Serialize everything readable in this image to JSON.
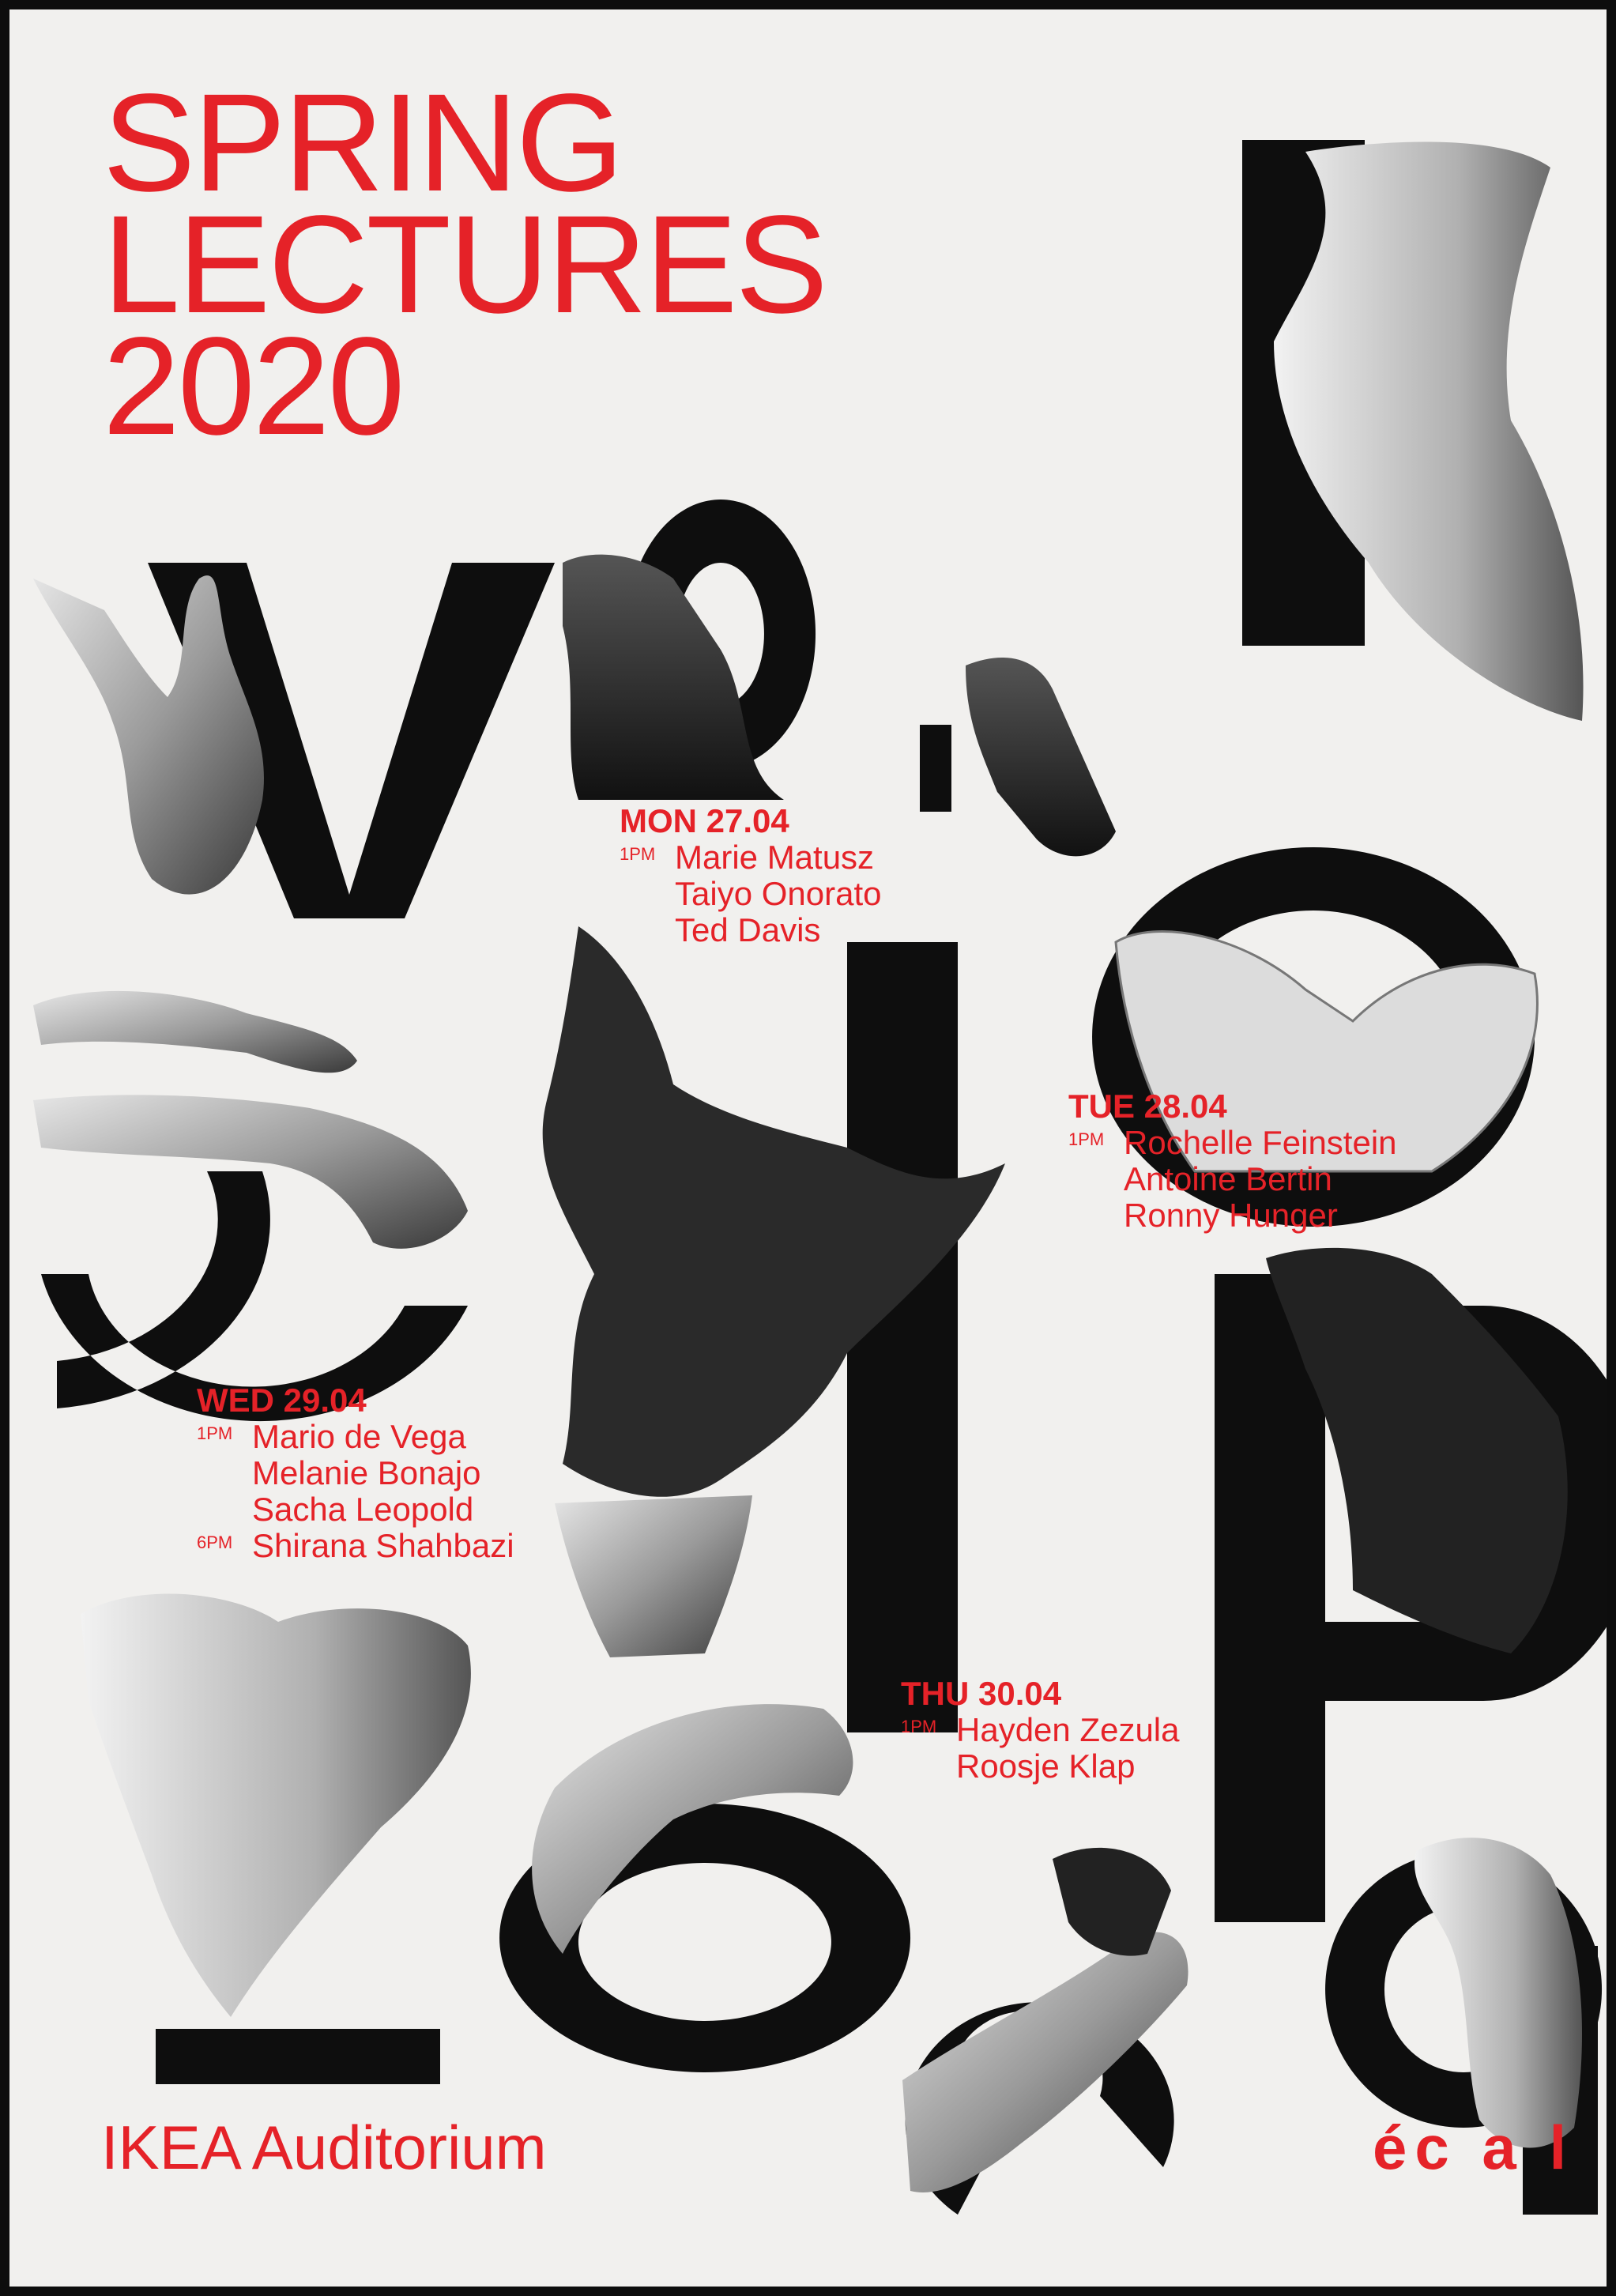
{
  "title": {
    "line1": "SPRING",
    "line2": "LECTURES",
    "line3": "2020"
  },
  "schedule": [
    {
      "day": "MON 27.04",
      "slots": [
        {
          "time": "1PM",
          "names": [
            "Marie Matusz",
            "Taiyo Onorato",
            "Ted Davis"
          ]
        }
      ]
    },
    {
      "day": "TUE 28.04",
      "slots": [
        {
          "time": "1PM",
          "names": [
            "Rochelle Feinstein",
            "Antoine Bertin",
            "Ronny Hunger"
          ]
        }
      ]
    },
    {
      "day": "WED 29.04",
      "slots": [
        {
          "time": "1PM",
          "names": [
            "Mario de Vega",
            "Melanie Bonajo",
            "Sacha Leopold"
          ]
        },
        {
          "time": "6PM",
          "names": [
            "Shirana Shahbazi"
          ]
        }
      ]
    },
    {
      "day": "THU 30.04",
      "slots": [
        {
          "time": "1PM",
          "names": [
            "Hayden Zezula",
            "Roosje Klap"
          ]
        }
      ]
    }
  ],
  "venue": "IKEA Auditorium",
  "logo": "éc a l",
  "colors": {
    "accent": "#e52228",
    "ink": "#0e0e0e",
    "paper": "#f1f0ee",
    "frame": "#0d0d0d"
  }
}
